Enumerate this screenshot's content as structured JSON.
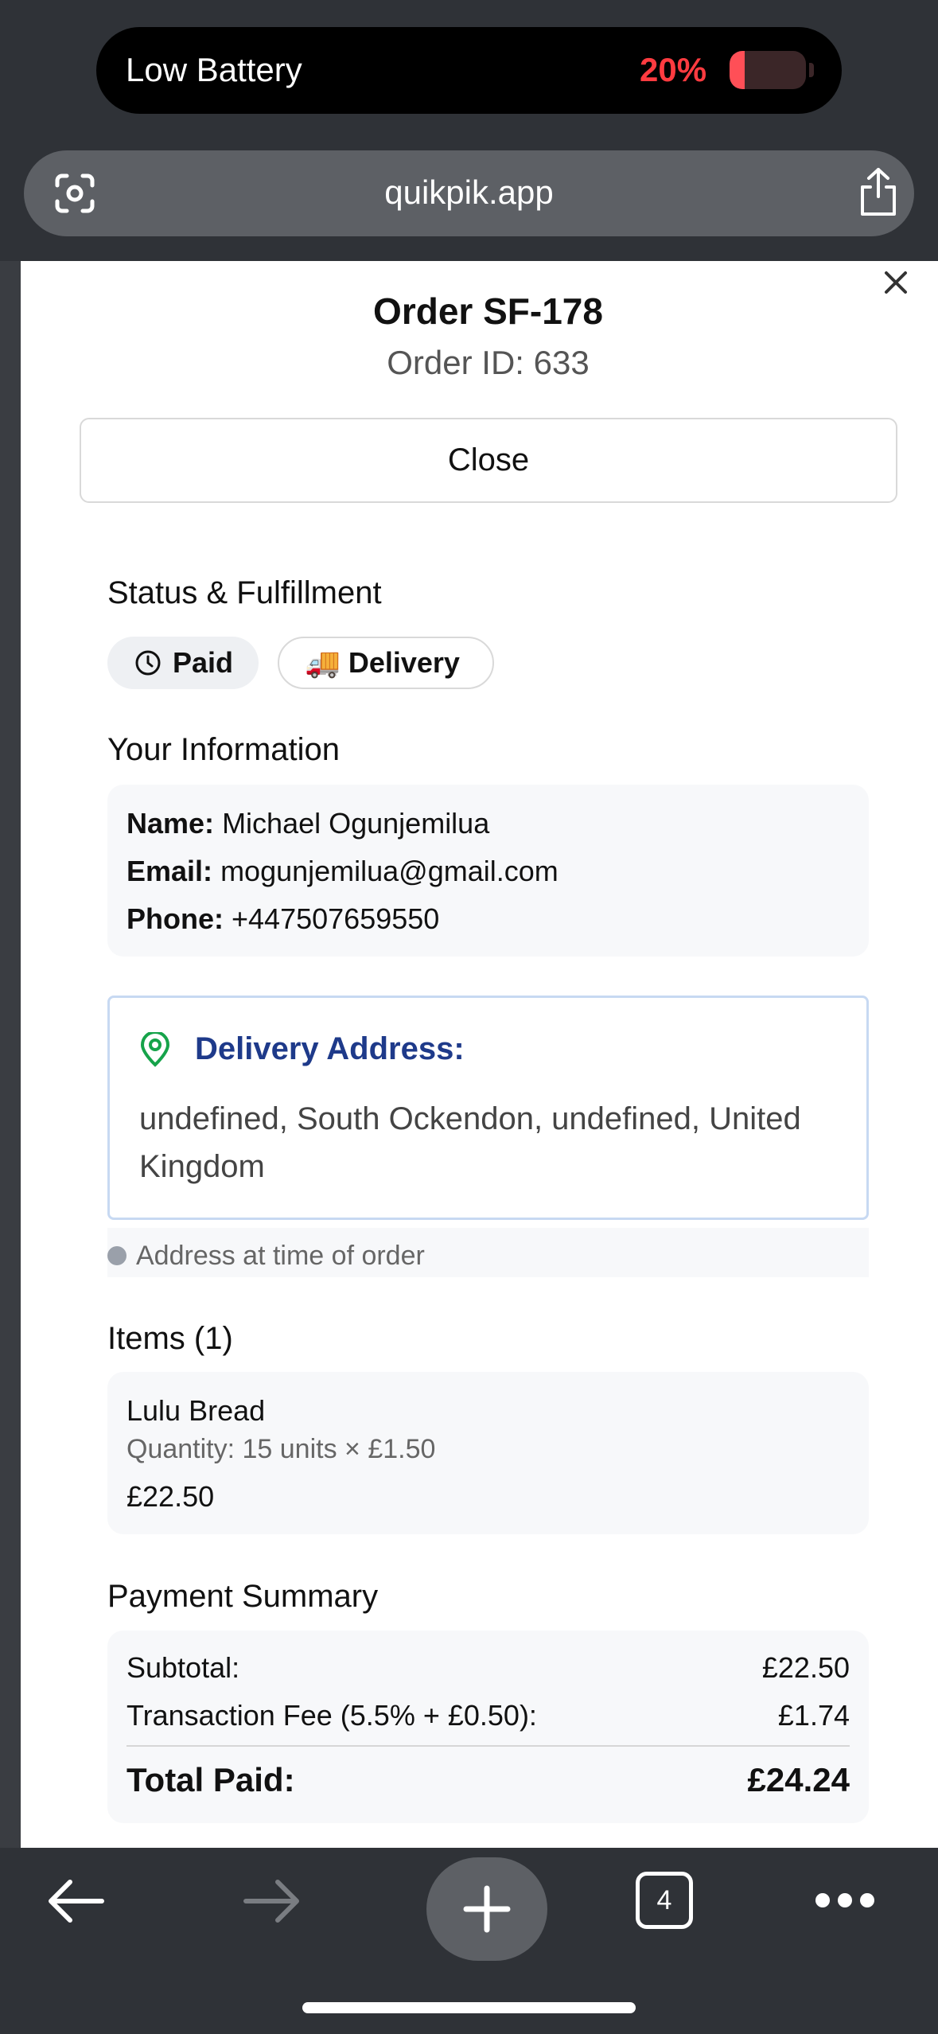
{
  "status": {
    "label": "Low Battery",
    "percent_label": "20%",
    "battery_level": 0.2
  },
  "browser": {
    "url": "quikpik.app",
    "tab_count": "4"
  },
  "order": {
    "title": "Order SF-178",
    "subtitle": "Order ID: 633",
    "close_label": "Close"
  },
  "status_section": {
    "title": "Status & Fulfillment",
    "paid_label": "Paid",
    "delivery_label": "Delivery",
    "delivery_emoji": "🚚"
  },
  "info": {
    "title": "Your Information",
    "name_label": "Name:",
    "name": "Michael Ogunjemilua",
    "email_label": "Email:",
    "email": "mogunjemilua@gmail.com",
    "phone_label": "Phone:",
    "phone": "+447507659550"
  },
  "address": {
    "title": "Delivery Address:",
    "text": "undefined, South Ockendon, undefined, United Kingdom",
    "note": "Address at time of order"
  },
  "items": {
    "title": "Items (1)",
    "list": [
      {
        "name": "Lulu Bread",
        "quantity": "Quantity: 15 units × £1.50",
        "price": "£22.50"
      }
    ]
  },
  "payment": {
    "title": "Payment Summary",
    "subtotal_label": "Subtotal:",
    "subtotal": "£22.50",
    "fee_label": "Transaction Fee (5.5% + £0.50):",
    "fee": "£1.74",
    "total_label": "Total Paid:",
    "total": "£24.24"
  },
  "colors": {
    "accent_blue": "#1e3a8a",
    "pin_green": "#16a34a",
    "battery_red": "#ff3b40"
  }
}
